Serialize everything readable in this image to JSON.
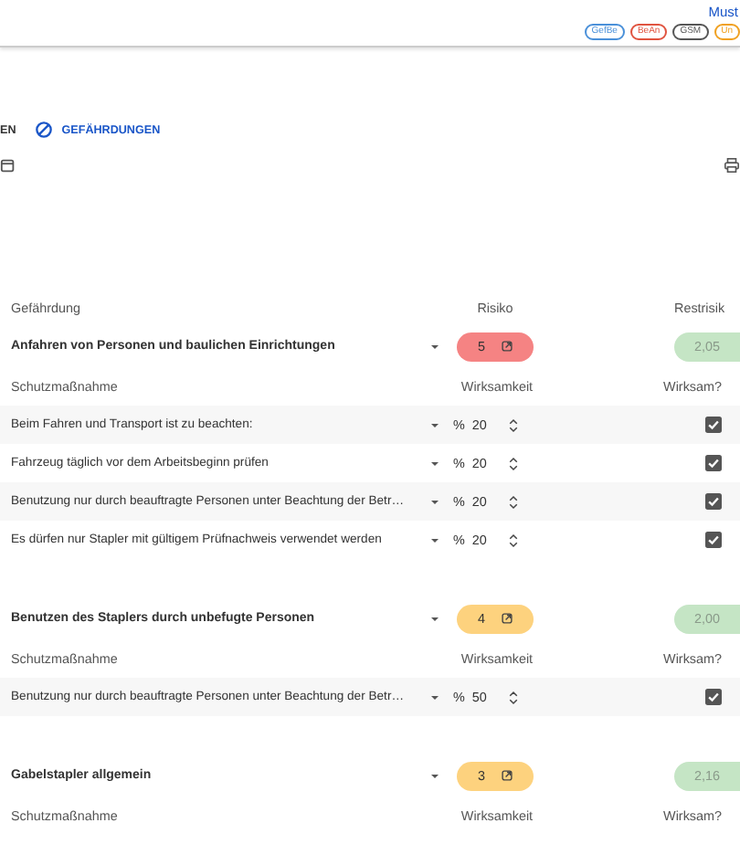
{
  "header": {
    "user": "Must",
    "chips": [
      {
        "label": "GefBe",
        "color": "#4a90d9"
      },
      {
        "label": "BeAn",
        "color": "#e0533f"
      },
      {
        "label": "GSM",
        "color": "#555555"
      },
      {
        "label": "Un",
        "color": "#f0a020"
      }
    ]
  },
  "tabs": [
    {
      "label": "EN",
      "selected": false
    },
    {
      "label": "GEFÄHRDUNGEN",
      "selected": true
    }
  ],
  "table": {
    "columns": {
      "hazard": "Gefährdung",
      "risk": "Risiko",
      "residual": "Restrisik"
    },
    "groups": [
      {
        "name": "Anfahren von Personen und baulichen Einrichtungen",
        "risk": "5",
        "color": "#f58383",
        "residual": "2,05",
        "sub_columns": {
          "measure": "Schutzmaßnahme",
          "effect": "Wirksamkeit",
          "effective": "Wirksam?"
        },
        "measures": [
          {
            "name": "Beim Fahren und Transport ist zu beachten:",
            "unit": "%",
            "value": "20",
            "checked": true
          },
          {
            "name": "Fahrzeug täglich vor dem Arbeitsbeginn prüfen",
            "unit": "%",
            "value": "20",
            "checked": true
          },
          {
            "name": "Benutzung nur durch beauftragte Personen unter Beachtung der Betr…",
            "unit": "%",
            "value": "20",
            "checked": true
          },
          {
            "name": "Es dürfen nur Stapler mit gültigem Prüfnachweis verwendet werden",
            "unit": "%",
            "value": "20",
            "checked": true
          }
        ]
      },
      {
        "name": "Benutzen des Staplers durch unbefugte Personen",
        "risk": "4",
        "color": "#fdd27e",
        "residual": "2,00",
        "sub_columns": {
          "measure": "Schutzmaßnahme",
          "effect": "Wirksamkeit",
          "effective": "Wirksam?"
        },
        "measures": [
          {
            "name": "Benutzung nur durch beauftragte Personen unter Beachtung der Betr…",
            "unit": "%",
            "value": "50",
            "checked": true
          }
        ]
      },
      {
        "name": "Gabelstapler allgemein",
        "risk": "3",
        "color": "#fdd27e",
        "residual": "2,16",
        "sub_columns": {
          "measure": "Schutzmaßnahme",
          "effect": "Wirksamkeit",
          "effective": "Wirksam?"
        }
      }
    ]
  }
}
